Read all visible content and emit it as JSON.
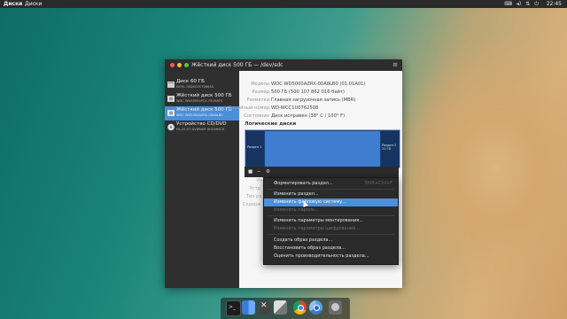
{
  "topbar": {
    "app": "Диски",
    "menu": "Диски",
    "time": "22:45",
    "icons": [
      "keyboard-icon",
      "volume-icon",
      "network-icon",
      "power-icon"
    ]
  },
  "window": {
    "title": "Жёсткий диск 500 ГБ — /dev/sdc"
  },
  "drives": [
    {
      "name": "Диск 60 ГБ",
      "sub": "INTEL SSDSC2CT060A3"
    },
    {
      "name": "Жёсткий диск 500 ГБ",
      "sub": "WDC WD5000LPCX-75VHAT0"
    },
    {
      "name": "Жёсткий диск 500 ГБ",
      "sub": "WDC WD5000AZRX-00A8LB0"
    },
    {
      "name": "Устройство CD/DVD",
      "sub": "HL-DT-ST DVDRAM GH24NSC0"
    }
  ],
  "info": [
    {
      "key": "Модель",
      "value": "WDC WD5000AZRX-00A8LB0 (01.01A01)"
    },
    {
      "key": "Размер",
      "value": "500 ГБ (500 107 862 016 байт)"
    },
    {
      "key": "Разметка",
      "value": "Главная загрузочная запись (MBR)"
    },
    {
      "key": "Серийный номер",
      "value": "WD-WCC1U0762508"
    },
    {
      "key": "Состояние",
      "value": "Диск исправен (38° C / 100° F)"
    }
  ],
  "volumes": {
    "section": "Логические диски",
    "partitions": [
      "Раздел 1\n21 ГБ",
      "Раздел 2\n..."
    ],
    "left_label": "Раздел 1",
    "right_label": "Раздел 2\n21 ГБ"
  },
  "faded": [
    "Ра",
    "Устр",
    "Тип ра",
    "Содерж"
  ],
  "context_menu": [
    {
      "label": "Форматировать раздел...",
      "shortcut": "Shift+Ctrl+F",
      "state": "en"
    },
    {
      "label": "Изменить раздел...",
      "shortcut": "",
      "state": "en"
    },
    {
      "label": "Изменить файловую систему...",
      "shortcut": "",
      "state": "hl"
    },
    {
      "label": "Изменить пароль...",
      "shortcut": "",
      "state": "dis"
    },
    {
      "label": "Изменить параметры монтирования...",
      "shortcut": "",
      "state": "en"
    },
    {
      "label": "Изменить параметры шифрования...",
      "shortcut": "",
      "state": "dis"
    },
    {
      "label": "Создать образ раздела...",
      "shortcut": "",
      "state": "en"
    },
    {
      "label": "Восстановить образ раздела...",
      "shortcut": "",
      "state": "en"
    },
    {
      "label": "Оценить производительность раздела...",
      "shortcut": "",
      "state": "en"
    }
  ],
  "dock": [
    "terminal-icon",
    "files-icon",
    "crossover-icon",
    "text-editor-icon",
    "chrome-icon",
    "chromium-icon",
    "disk-utility-icon"
  ],
  "colors": {
    "accent": "#4a8fd9",
    "topbar": "#2a2a2a",
    "sidebar": "#2f2f2f"
  }
}
